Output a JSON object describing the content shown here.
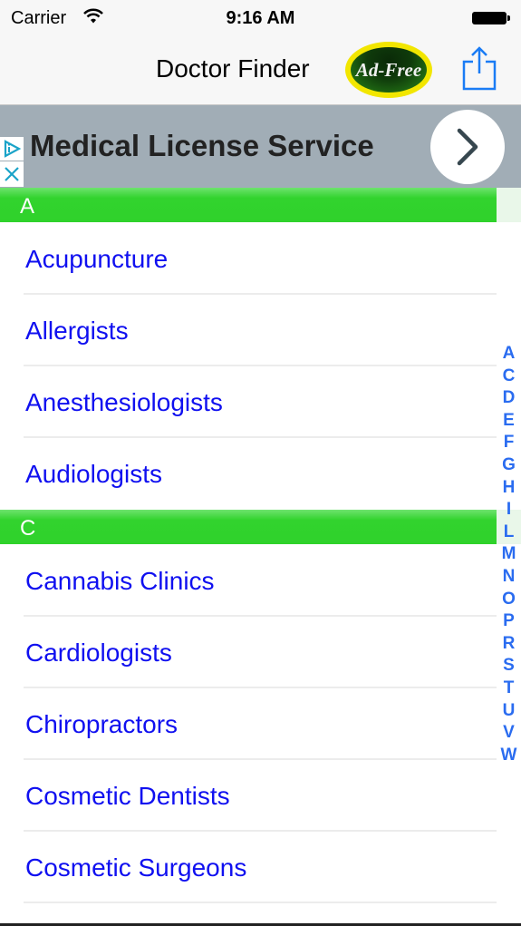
{
  "status_bar": {
    "carrier": "Carrier",
    "time": "9:16 AM",
    "wifi_icon": "wifi-icon",
    "battery_icon": "battery-full-icon"
  },
  "nav_bar": {
    "title": "Doctor Finder",
    "ad_free_badge": "Ad-Free",
    "share_icon": "share-icon",
    "accent_color": "#1a7cf5"
  },
  "ad_banner": {
    "title": "Medical License Service",
    "info_icon": "ad-choices-icon",
    "close_icon": "close-icon",
    "arrow_icon": "chevron-right-icon",
    "background_color": "#a1adb6"
  },
  "sections": [
    {
      "header": "A",
      "items": [
        "Acupuncture",
        "Allergists",
        "Anesthesiologists",
        "Audiologists"
      ]
    },
    {
      "header": "C",
      "items": [
        "Cannabis Clinics",
        "Cardiologists",
        "Chiropractors",
        "Cosmetic Dentists",
        "Cosmetic Surgeons"
      ]
    }
  ],
  "section_index": [
    "A",
    "C",
    "D",
    "E",
    "F",
    "G",
    "H",
    "I",
    "L",
    "M",
    "N",
    "O",
    "P",
    "R",
    "S",
    "T",
    "U",
    "V",
    "W"
  ],
  "colors": {
    "section_header": "#2fd22b",
    "item_text": "#1010f0",
    "index_text": "#2a6cf0"
  }
}
